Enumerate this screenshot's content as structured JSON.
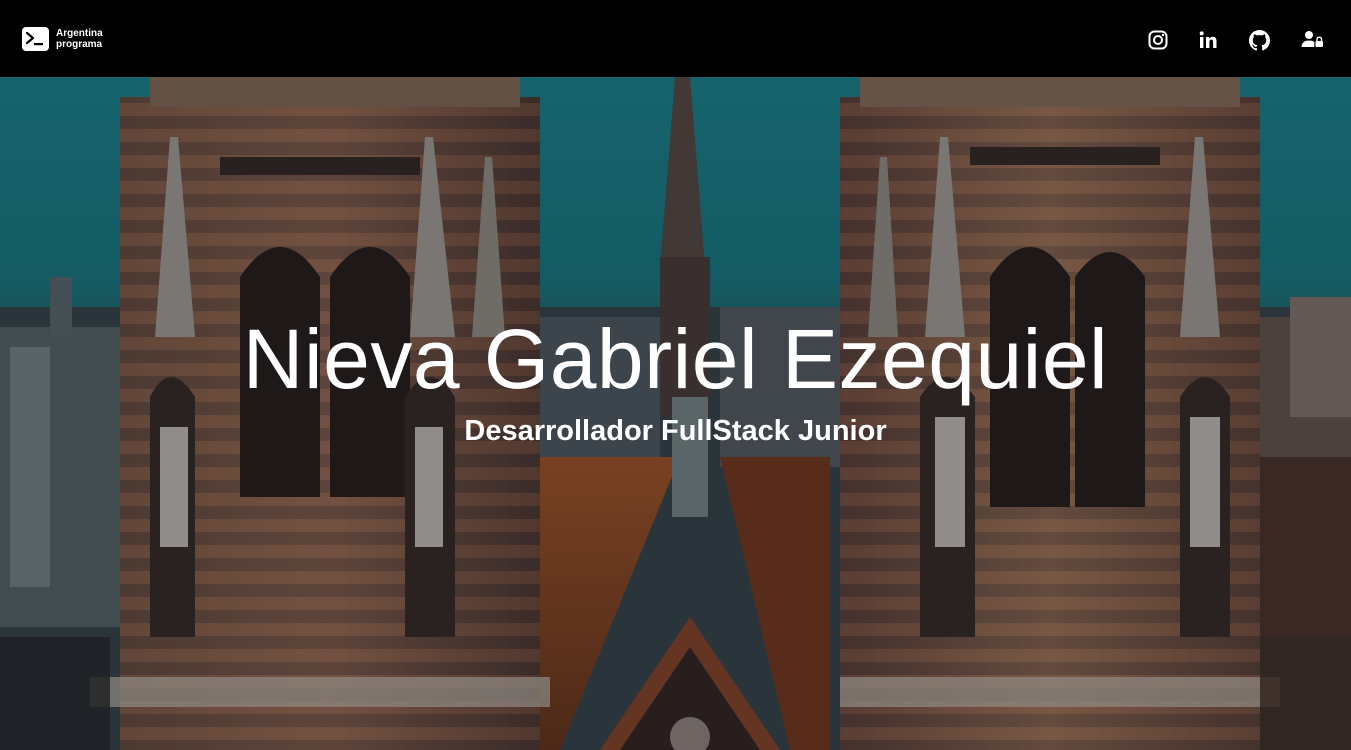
{
  "navbar": {
    "brand": {
      "line1": "Argentina",
      "line2": "programa",
      "icon": "terminal-icon"
    },
    "links": [
      {
        "name": "instagram",
        "icon": "instagram-icon"
      },
      {
        "name": "linkedin",
        "icon": "linkedin-icon",
        "text": "in"
      },
      {
        "name": "github",
        "icon": "github-icon"
      },
      {
        "name": "login",
        "icon": "user-lock-icon"
      }
    ]
  },
  "hero": {
    "title": "Nieva Gabriel Ezequiel",
    "subtitle": "Desarrollador FullStack Junior",
    "background_image": "cathedral-towers-photo"
  },
  "colors": {
    "navbar_bg": "#000000",
    "text": "#ffffff",
    "sky": "#1f8a97"
  }
}
